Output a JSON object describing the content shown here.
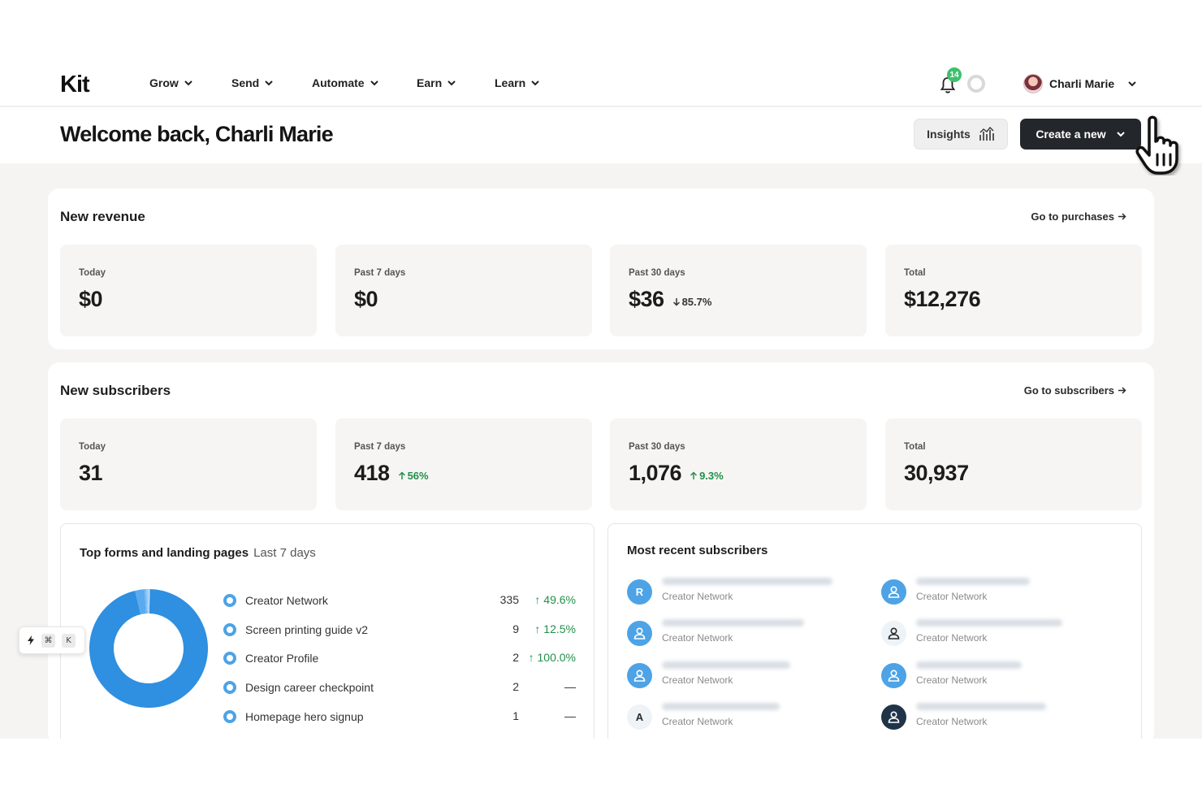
{
  "nav": {
    "items": [
      {
        "label": "Grow"
      },
      {
        "label": "Send"
      },
      {
        "label": "Automate"
      },
      {
        "label": "Earn"
      },
      {
        "label": "Learn"
      }
    ],
    "notification_count": "14",
    "user_name": "Charli Marie"
  },
  "header": {
    "welcome": "Welcome back, Charli Marie",
    "insights_label": "Insights",
    "create_label": "Create a new"
  },
  "revenue": {
    "title": "New revenue",
    "link": "Go to purchases",
    "cards": [
      {
        "label": "Today",
        "value": "$0",
        "delta": ""
      },
      {
        "label": "Past 7 days",
        "value": "$0",
        "delta": ""
      },
      {
        "label": "Past 30 days",
        "value": "$36",
        "delta": "85.7%",
        "delta_dir": "down"
      },
      {
        "label": "Total",
        "value": "$12,276",
        "delta": ""
      }
    ]
  },
  "subscribers": {
    "title": "New subscribers",
    "link": "Go to subscribers",
    "cards": [
      {
        "label": "Today",
        "value": "31",
        "delta": ""
      },
      {
        "label": "Past 7 days",
        "value": "418",
        "delta": "56%",
        "delta_dir": "up"
      },
      {
        "label": "Past 30 days",
        "value": "1,076",
        "delta": "9.3%",
        "delta_dir": "up"
      },
      {
        "label": "Total",
        "value": "30,937",
        "delta": ""
      }
    ]
  },
  "top_forms": {
    "title": "Top forms and landing pages",
    "period": "Last 7 days",
    "items": [
      {
        "name": "Creator Network",
        "count": "335",
        "change": "49.6%",
        "trend": "up"
      },
      {
        "name": "Screen printing guide v2",
        "count": "9",
        "change": "12.5%",
        "trend": "up"
      },
      {
        "name": "Creator Profile",
        "count": "2",
        "change": "100.0%",
        "trend": "up"
      },
      {
        "name": "Design career checkpoint",
        "count": "2",
        "change": "—",
        "trend": "flat"
      },
      {
        "name": "Homepage hero signup",
        "count": "1",
        "change": "—",
        "trend": "flat"
      }
    ]
  },
  "chart_data": {
    "type": "pie",
    "categories": [
      "Creator Network",
      "Screen printing guide v2",
      "Creator Profile",
      "Design career checkpoint",
      "Homepage hero signup"
    ],
    "values": [
      335,
      9,
      2,
      2,
      1
    ],
    "colors": [
      "#2f8fe0",
      "#5aaaf0",
      "#7bbcf3",
      "#9ccdf6",
      "#bcdef9"
    ]
  },
  "recent_subscribers": {
    "title": "Most recent subscribers",
    "items": [
      {
        "initial": "R",
        "style": "blue",
        "source": "Creator Network"
      },
      {
        "initial": "",
        "style": "blue",
        "source": "Creator Network"
      },
      {
        "initial": "",
        "style": "blue",
        "source": "Creator Network"
      },
      {
        "initial": "",
        "style": "light",
        "source": "Creator Network"
      },
      {
        "initial": "",
        "style": "blue",
        "source": "Creator Network"
      },
      {
        "initial": "",
        "style": "blue",
        "source": "Creator Network"
      },
      {
        "initial": "A",
        "style": "light",
        "source": "Creator Network"
      },
      {
        "initial": "",
        "style": "dark",
        "source": "Creator Network"
      }
    ]
  },
  "shortcut": {
    "key1": "⌘",
    "key2": "K"
  },
  "colors": {
    "accent": "#4da3e6",
    "positive": "#22904a",
    "dark_button": "#23272b"
  }
}
